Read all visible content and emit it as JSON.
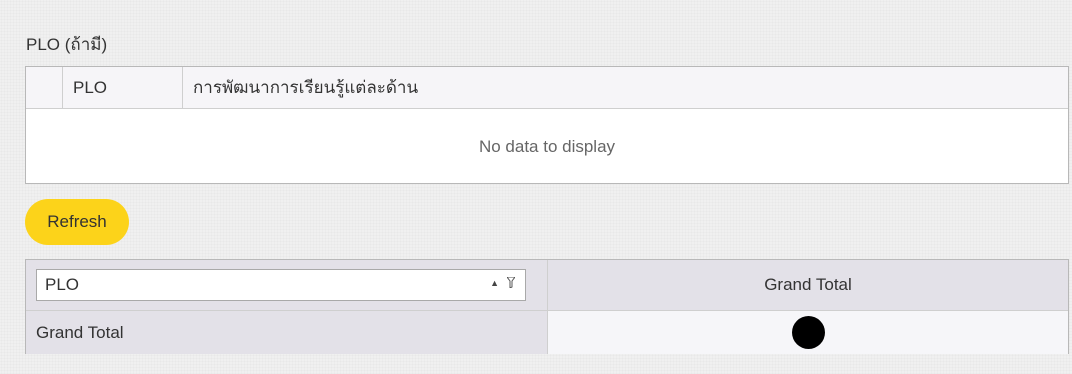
{
  "section": {
    "title": "PLO (ถ้ามี)"
  },
  "plo_grid": {
    "columns": [
      "",
      "PLO",
      "การพัฒนาการเรียนรู้แต่ละด้าน"
    ],
    "empty_text": "No data to display"
  },
  "refresh_label": "Refresh",
  "pivot": {
    "row_field": "PLO",
    "column_header": "Grand Total",
    "row_header": "Grand Total"
  },
  "colors": {
    "accent": "#fcd31a",
    "header_bg": "#e3e1e8"
  }
}
